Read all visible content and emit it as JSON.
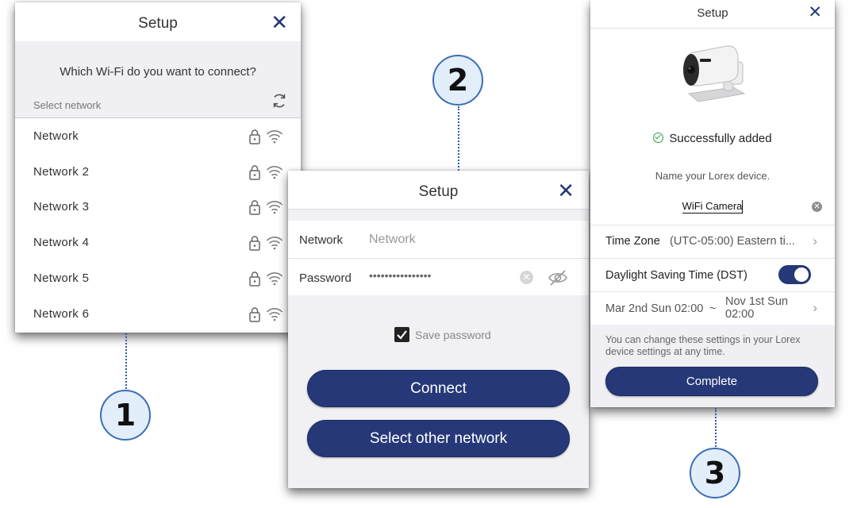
{
  "panel1": {
    "title": "Setup",
    "close_icon": "close-icon",
    "question": "Which Wi-Fi do you want to connect?",
    "select_label": "Select network",
    "refresh_icon": "refresh-icon",
    "networks": [
      {
        "name": "Network"
      },
      {
        "name": "Network 2"
      },
      {
        "name": "Network 3"
      },
      {
        "name": "Network 4"
      },
      {
        "name": "Network 5"
      },
      {
        "name": "Network 6"
      }
    ]
  },
  "panel2": {
    "title": "Setup",
    "network_label": "Network",
    "network_value": "Network",
    "password_label": "Password",
    "password_value": "••••••••••••••••",
    "save_label": "Save password",
    "save_checked": true,
    "connect_label": "Connect",
    "other_label": "Select other network"
  },
  "panel3": {
    "title": "Setup",
    "status": "Successfully added",
    "name_prompt": "Name your Lorex device.",
    "device_name": "WiFi Camera",
    "timezone_label": "Time Zone",
    "timezone_value": "(UTC-05:00) Eastern ti...",
    "dst_label": "Daylight Saving Time (DST)",
    "dst_enabled": true,
    "dst_start": "Mar 2nd Sun 02:00",
    "dst_sep": "~",
    "dst_end_line1": "Nov 1st Sun",
    "dst_end_line2": "02:00",
    "note": "You can change these settings in your Lorex device settings at any time.",
    "complete_label": "Complete"
  },
  "steps": [
    "1",
    "2",
    "3"
  ],
  "colors": {
    "accent": "#263877",
    "success": "#2aa54a",
    "callout_fill": "#e2eefa",
    "callout_border": "#3a6fb5"
  }
}
